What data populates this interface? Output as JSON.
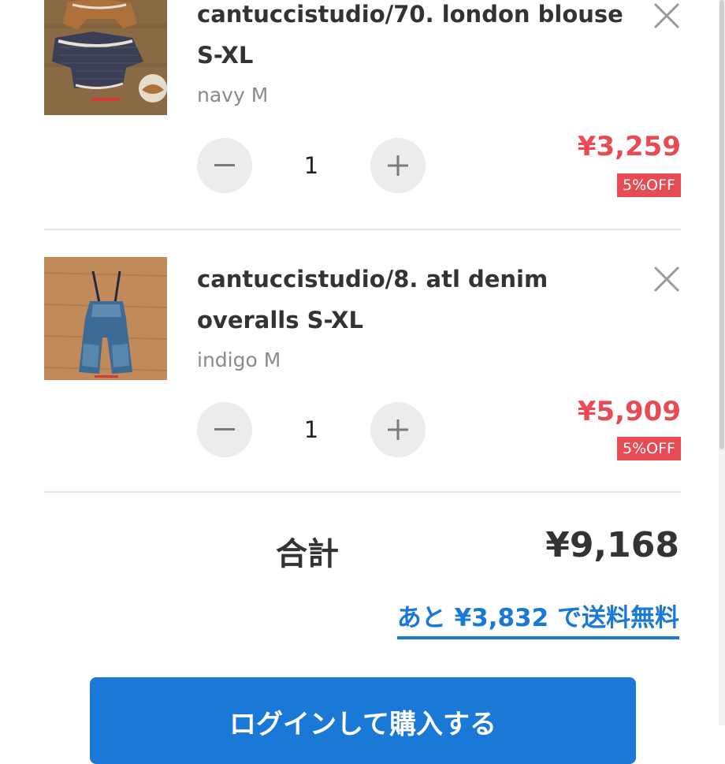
{
  "cart": {
    "items": [
      {
        "title": "cantuccistudio/70. london blouse S-XL",
        "variant": "navy M",
        "quantity": "1",
        "price": "¥3,259",
        "discount_badge": "5%OFF"
      },
      {
        "title": "cantuccistudio/8. atl denim overalls S-XL",
        "variant": "indigo M",
        "quantity": "1",
        "price": "¥5,909",
        "discount_badge": "5%OFF"
      }
    ],
    "icons": {
      "remove": "close-icon",
      "decrease": "minus-icon",
      "increase": "plus-icon"
    }
  },
  "summary": {
    "total_label": "合計",
    "total_value": "¥9,168",
    "free_shipping_link": "あと ¥3,832 で送料無料"
  },
  "checkout": {
    "button_label": "ログインして購入する"
  },
  "colors": {
    "price": "#e94b55",
    "badge_bg": "#e94b55",
    "link": "#1a78d6",
    "cta_bg": "#1a78d6",
    "text": "#333333",
    "muted": "#8a8a8a"
  }
}
